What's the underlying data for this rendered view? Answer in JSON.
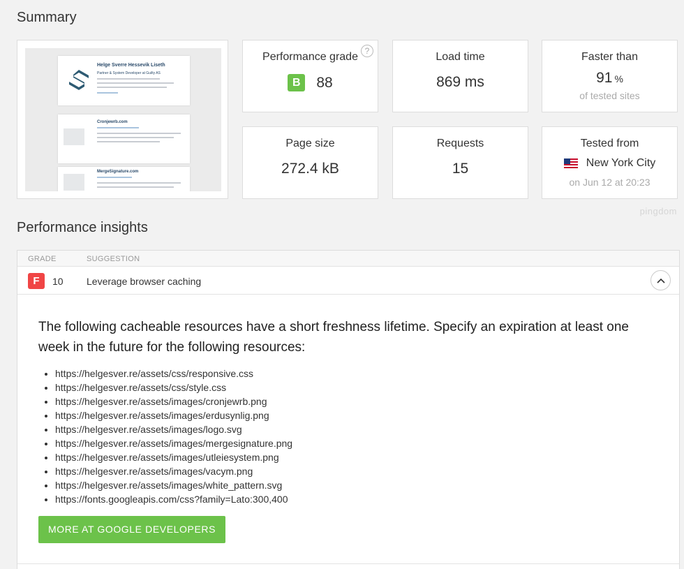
{
  "summary": {
    "title": "Summary",
    "screenshot": {
      "name": "Helge Sverre Hessevik Liseth",
      "subtitle": "Partner & System Developer at Guilty AS",
      "item1": "Cronjewrb.com",
      "item2": "MergeSignature.com"
    },
    "performance_grade": {
      "label": "Performance grade",
      "letter": "B",
      "score": "88",
      "color": "#6cc24a",
      "help": "?"
    },
    "load_time": {
      "label": "Load time",
      "value": "869 ms"
    },
    "faster_than": {
      "label": "Faster than",
      "value": "91",
      "unit": "%",
      "sub": "of tested sites"
    },
    "page_size": {
      "label": "Page size",
      "value": "272.4 kB"
    },
    "requests": {
      "label": "Requests",
      "value": "15"
    },
    "tested_from": {
      "label": "Tested from",
      "location": "New York City",
      "date": "on Jun 12 at 20:23"
    },
    "brand": "pingdom"
  },
  "insights": {
    "title": "Performance insights",
    "columns": {
      "grade": "GRADE",
      "suggestion": "SUGGESTION"
    },
    "rows": [
      {
        "grade": "F",
        "score": "10",
        "suggestion": "Leverage browser caching",
        "expanded": true,
        "description": "The following cacheable resources have a short freshness lifetime. Specify an expiration at least one week in the future for the following resources:",
        "resources": [
          "https://helgesver.re/assets/css/responsive.css",
          "https://helgesver.re/assets/css/style.css",
          "https://helgesver.re/assets/images/cronjewrb.png",
          "https://helgesver.re/assets/images/erdusynlig.png",
          "https://helgesver.re/assets/images/logo.svg",
          "https://helgesver.re/assets/images/mergesignature.png",
          "https://helgesver.re/assets/images/utleiesystem.png",
          "https://helgesver.re/assets/images/vacym.png",
          "https://helgesver.re/assets/images/white_pattern.svg",
          "https://fonts.googleapis.com/css?family=Lato:300,400"
        ],
        "button_label": "MORE AT GOOGLE DEVELOPERS"
      }
    ],
    "grade_f_color": "#f04545"
  }
}
